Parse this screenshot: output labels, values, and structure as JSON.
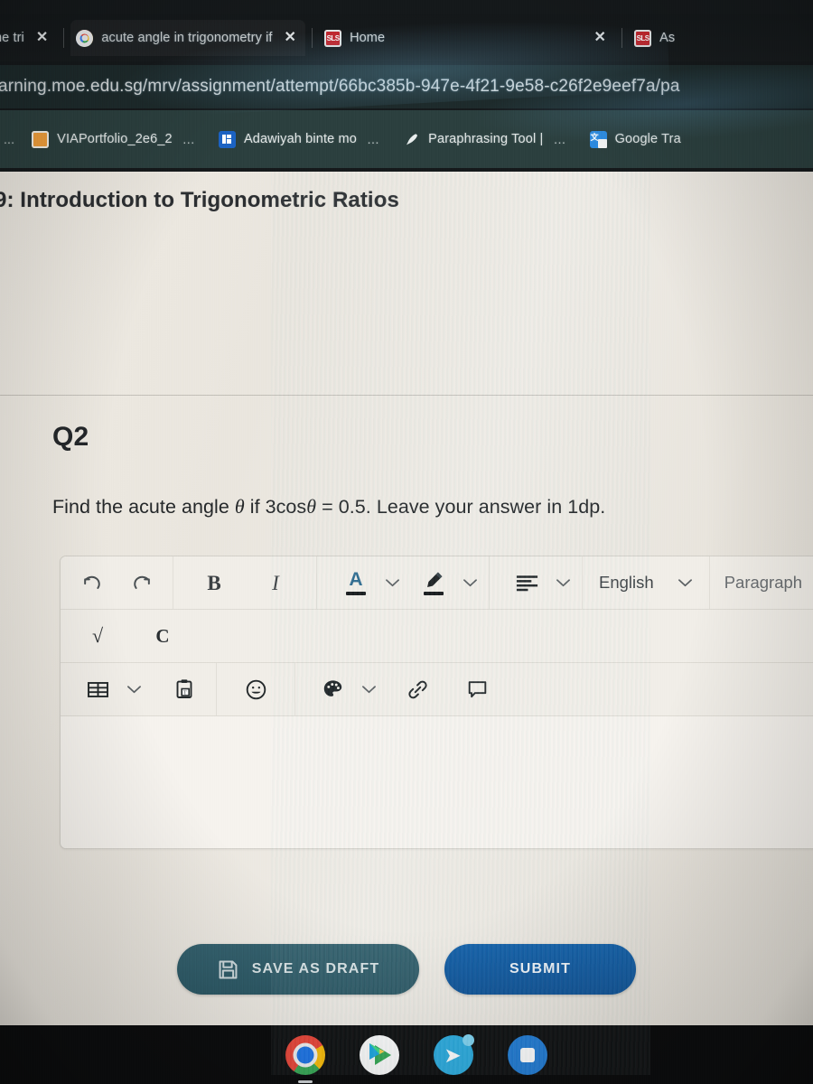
{
  "browser": {
    "tabs": [
      {
        "title": "he tri",
        "favicon": "generic-icon",
        "active": false,
        "truncated": true
      },
      {
        "title": "acute angle in trigonometry if",
        "favicon": "google-icon",
        "active": true,
        "truncated": false
      },
      {
        "title": "Home",
        "favicon": "sls-icon",
        "active": false,
        "truncated": false
      },
      {
        "title": "As",
        "favicon": "sls-icon",
        "active": false,
        "truncated": true
      }
    ],
    "close_label": "✕",
    "url": "arning.moe.edu.sg/mrv/assignment/attempt/66bc385b-947e-4f21-9e58-c26f2e9eef7a/pa",
    "bookmarks": [
      {
        "label": "...",
        "icon": "generic-bookmark-icon",
        "color": "#6b7a79"
      },
      {
        "label": "VIAPortfolio_2e6_2",
        "icon": "folder-icon",
        "color": "#f2a03c",
        "ellipsis": "…"
      },
      {
        "label": "Adawiyah binte mo",
        "icon": "sharepoint-icon",
        "color": "#1b63c4",
        "ellipsis": "…"
      },
      {
        "label": "Paraphrasing Tool |",
        "icon": "quill-icon",
        "color": "#dfe4e3",
        "ellipsis": "…"
      },
      {
        "label": "Google Tra",
        "icon": "google-translate-icon",
        "color": "#2b8ae0",
        "ellipsis": ""
      }
    ]
  },
  "page": {
    "lesson_title": "9: Introduction to Trigonometric Ratios",
    "question": {
      "number": "Q2",
      "prefix": "Find the acute angle ",
      "var1": "θ",
      "mid": " if 3cos",
      "var2": "θ",
      "suffix": " = 0.5. Leave your answer in 1dp."
    },
    "editor": {
      "content": "",
      "placeholder": "",
      "toolbar_row1": [
        {
          "name": "undo",
          "label": "undo-icon"
        },
        {
          "name": "redo",
          "label": "redo-icon"
        },
        {
          "name": "bold",
          "label": "B"
        },
        {
          "name": "italic",
          "label": "I"
        },
        {
          "name": "text-color",
          "label": "A"
        },
        {
          "name": "highlight",
          "label": "pen-icon"
        },
        {
          "name": "align",
          "label": "align-left-icon"
        },
        {
          "name": "language",
          "label": "English"
        },
        {
          "name": "block-format",
          "label": "Paragraph"
        },
        {
          "name": "numbered-list",
          "label": "numbered-list-icon"
        }
      ],
      "toolbar_row2": [
        {
          "name": "math-sqrt",
          "label": "√"
        },
        {
          "name": "special-char",
          "label": "C"
        }
      ],
      "toolbar_row3": [
        {
          "name": "insert-table",
          "label": "table-icon"
        },
        {
          "name": "paste-as-text",
          "label": "clipboard-text-icon"
        },
        {
          "name": "emoji",
          "label": "☺"
        },
        {
          "name": "palette",
          "label": "palette-icon"
        },
        {
          "name": "insert-link",
          "label": "link-icon"
        },
        {
          "name": "comment",
          "label": "comment-icon"
        }
      ],
      "language_value": "English",
      "format_value": "Paragraph",
      "caret_down": "⌄"
    },
    "actions": {
      "save_draft_label": "SAVE AS DRAFT",
      "save_draft_icon": "floppy-disk-icon",
      "submit_label": "SUBMIT"
    }
  },
  "shelf": {
    "items": [
      {
        "name": "chrome",
        "label": "chrome-icon"
      },
      {
        "name": "play-store",
        "label": "play-store-icon"
      },
      {
        "name": "telegram",
        "label": "telegram-icon"
      },
      {
        "name": "blue-app",
        "label": "blue-app-icon"
      }
    ]
  },
  "colors": {
    "tab_bar": "#15191b",
    "omnibox": "#1d2a2b",
    "bookmarks_bar": "#2b3f3e",
    "page_bg": "#e9e5dd",
    "submit_blue": "#115fa8",
    "draft_teal": "#34616e",
    "shelf": "#0c0d0e"
  }
}
